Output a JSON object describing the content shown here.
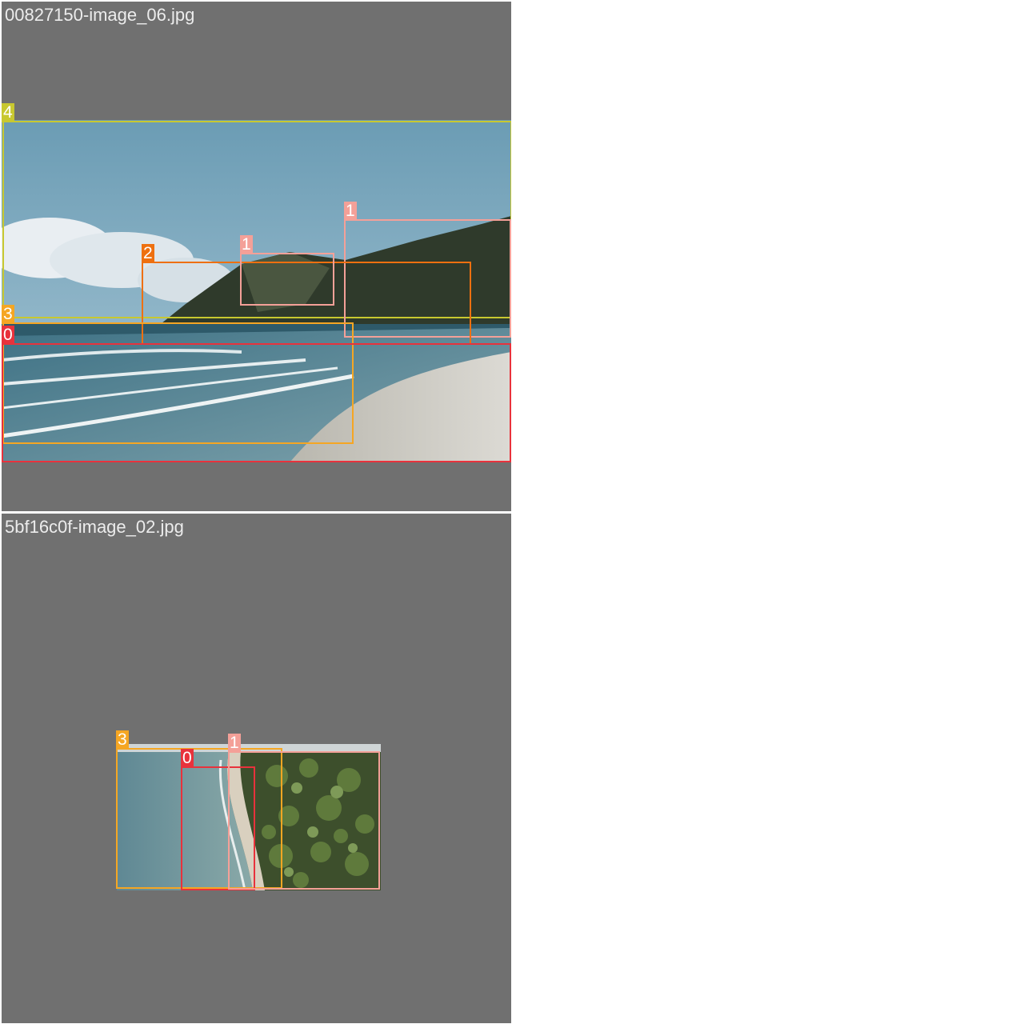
{
  "tiles": [
    {
      "filename": "00827150-image_06.jpg",
      "labels": [
        {
          "class": "4",
          "color": "#c8c830"
        },
        {
          "class": "1",
          "color": "#f4a098"
        },
        {
          "class": "2",
          "color": "#ee7010"
        },
        {
          "class": "1",
          "color": "#f4a098"
        },
        {
          "class": "3",
          "color": "#f5a623"
        },
        {
          "class": "0",
          "color": "#e8323c"
        }
      ]
    },
    {
      "filename": "5bf16c0f-image_02.jpg",
      "labels": [
        {
          "class": "3",
          "color": "#f5a623"
        },
        {
          "class": "0",
          "color": "#e8323c"
        },
        {
          "class": "1",
          "color": "#f4a098"
        }
      ]
    }
  ]
}
